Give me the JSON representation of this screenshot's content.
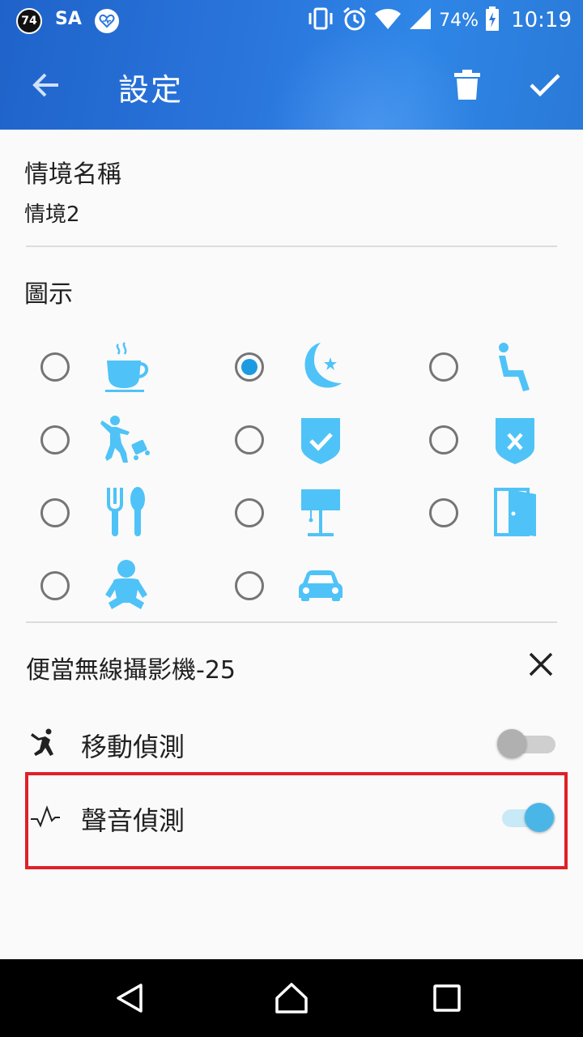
{
  "status_bar": {
    "badge": "74",
    "carrier": "SA",
    "battery": "74%",
    "time": "10:19"
  },
  "app_bar": {
    "title": "設定",
    "back_icon": "arrow-back-icon",
    "delete_icon": "trash-icon",
    "confirm_icon": "check-icon"
  },
  "scene_name": {
    "label": "情境名稱",
    "value": "情境2"
  },
  "icon_section": {
    "label": "圖示",
    "selected": "moon",
    "options": [
      "coffee",
      "moon",
      "seat",
      "traveler",
      "shield-check",
      "shield-x",
      "dining",
      "lamp",
      "door",
      "baby",
      "car"
    ]
  },
  "camera": {
    "title": "便當無線攝影機-25",
    "remove_icon": "close-icon",
    "motion_label": "移動偵測",
    "motion_on": false,
    "sound_label": "聲音偵測",
    "sound_on": true
  },
  "colors": {
    "accent": "#1e9ae0",
    "icon_blue": "#4fc3f7",
    "highlight": "#e02027"
  }
}
